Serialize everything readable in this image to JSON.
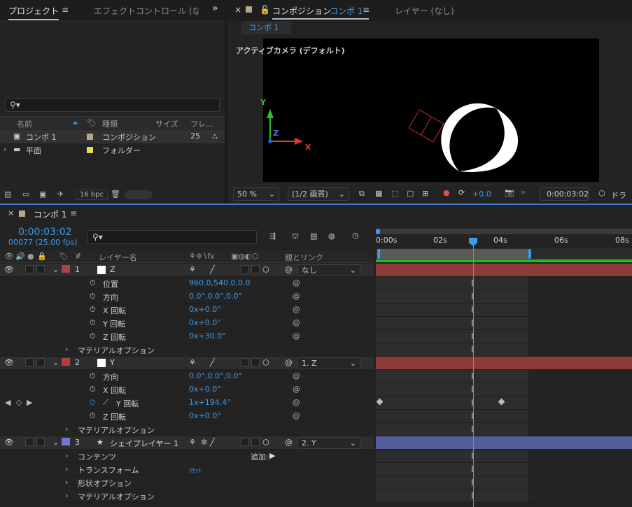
{
  "colors": {
    "accent": "#3d9bea",
    "layer_red": "#9e3b3b",
    "layer_purple": "#5b63a8",
    "green_bar": "#1fbe1f"
  },
  "project": {
    "tab_label": "プロジェクト",
    "menu_glyph": "≡",
    "effect_tab": "エフェクトコントロール (なし",
    "more_glyph": "»",
    "search_placeholder": "⚲▾",
    "columns": {
      "name": "名前",
      "type": "種類",
      "size": "サイズ",
      "frame": "フレ..."
    },
    "items": [
      {
        "name": "コンポ 1",
        "type": "コンポジション",
        "frame": "25",
        "swatch": "#b6a68a"
      },
      {
        "name": "平面",
        "type": "フォルダー",
        "frame": "",
        "swatch": "#e5dd5f"
      }
    ],
    "bpc": "16 bpc"
  },
  "comp": {
    "tab_label": "コンポジション",
    "tab_name": "コンポ 1",
    "menu_glyph": "≡",
    "layer_tab": "レイヤー (なし)",
    "subtab": "コンポ 1",
    "camera_label": "アクティブカメラ (デフォルト)",
    "axis_x": "X",
    "axis_y": "Y",
    "axis_z": "Z",
    "zoom": "50 %",
    "resolution": "(1/2 画質)",
    "exposure": "+0.0",
    "timecode": "0:00:03:02",
    "draft": "ドラ"
  },
  "timeline": {
    "tab_label": "コンポ 1",
    "menu_glyph": "≡",
    "timecode": "0:00:03:02",
    "frames": "00077 (25.00 fps)",
    "search_placeholder": "⚲▾",
    "col_hash": "#",
    "col_layer_name": "レイヤー名",
    "col_switches": "⚘✲∖fx",
    "col_parent": "親とリンク",
    "ruler": [
      "0:00s",
      "02s",
      "04s",
      "06s",
      "08s"
    ],
    "rows": [
      {
        "kind": "layer",
        "num": "1",
        "name": "Z",
        "color": "#b34040",
        "parent": "なし"
      },
      {
        "kind": "prop",
        "name": "位置",
        "value": "960.0,540.0,0.0"
      },
      {
        "kind": "prop",
        "name": "方向",
        "value": "0.0°,0.0°,0.0°"
      },
      {
        "kind": "prop",
        "name": "X 回転",
        "value": "0x+0.0°"
      },
      {
        "kind": "prop",
        "name": "Y 回転",
        "value": "0x+0.0°"
      },
      {
        "kind": "prop",
        "name": "Z 回転",
        "value": "0x+30.0°"
      },
      {
        "kind": "group",
        "name": "マテリアルオプション"
      },
      {
        "kind": "layer",
        "num": "2",
        "name": "Y",
        "color": "#b34040",
        "parent": "1. Z"
      },
      {
        "kind": "prop",
        "name": "方向",
        "value": "0.0°,0.0°,0.0°"
      },
      {
        "kind": "prop",
        "name": "X 回転",
        "value": "0x+0.0°"
      },
      {
        "kind": "prop",
        "name": "Y 回転",
        "value": "1x+194.4°"
      },
      {
        "kind": "prop",
        "name": "Z 回転",
        "value": "0x+0.0°"
      },
      {
        "kind": "group",
        "name": "マテリアルオプション"
      },
      {
        "kind": "layer",
        "num": "3",
        "name": "シェイプレイヤー 1",
        "color": "#6d7ad0",
        "parent": "2. Y"
      },
      {
        "kind": "group",
        "name": "コンテンツ",
        "extra": "追加:"
      },
      {
        "kind": "group",
        "name": "トランスフォーム",
        "extra_blue": "ﾘｾｯﾄ"
      },
      {
        "kind": "group",
        "name": "形状オプション"
      },
      {
        "kind": "group",
        "name": "マテリアルオプション"
      }
    ]
  }
}
